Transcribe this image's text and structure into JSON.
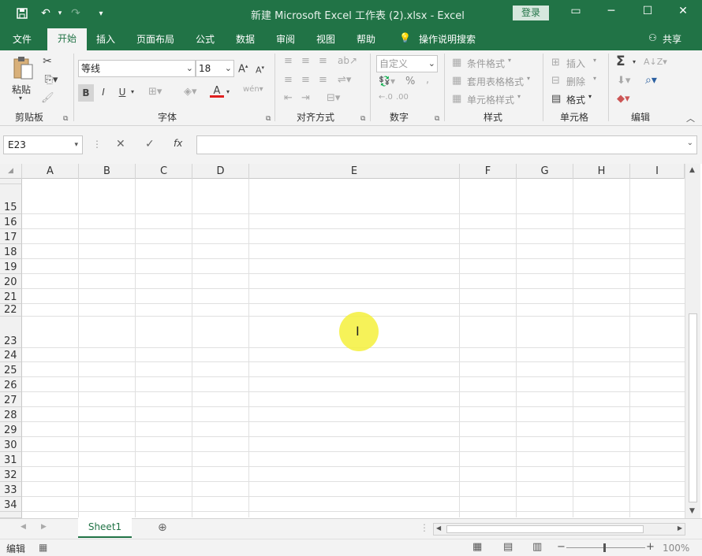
{
  "titlebar": {
    "title": "新建 Microsoft Excel 工作表 (2).xlsx  -  Excel",
    "login": "登录",
    "save_icon": "save-icon",
    "undo_icon": "undo-icon",
    "redo_icon": "redo-icon"
  },
  "tabs": [
    "文件",
    "开始",
    "插入",
    "页面布局",
    "公式",
    "数据",
    "审阅",
    "视图",
    "帮助"
  ],
  "tell_me": "操作说明搜索",
  "share": "共享",
  "ribbon": {
    "clipboard": {
      "paste": "粘贴",
      "label": "剪贴板"
    },
    "font": {
      "name": "等线",
      "size": "18",
      "bold": "B",
      "italic": "I",
      "underline": "U",
      "label": "字体"
    },
    "alignment": {
      "label": "对齐方式"
    },
    "number": {
      "format": "自定义",
      "label": "数字"
    },
    "styles": {
      "conditional": "条件格式",
      "table": "套用表格格式",
      "cell": "单元格样式",
      "label": "样式"
    },
    "cells": {
      "insert": "插入",
      "delete": "删除",
      "format": "格式",
      "label": "单元格"
    },
    "editing": {
      "label": "编辑"
    }
  },
  "formula_bar": {
    "name_box": "E23",
    "formula": "",
    "fx": "fx"
  },
  "columns": [
    "A",
    "B",
    "C",
    "D",
    "E",
    "F",
    "G",
    "H",
    "I"
  ],
  "rows": [
    "15",
    "16",
    "17",
    "18",
    "19",
    "20",
    "21",
    "22",
    "23",
    "24",
    "25",
    "26",
    "27",
    "28",
    "29",
    "30",
    "31",
    "32",
    "33",
    "34"
  ],
  "sheet_tab": "Sheet1",
  "status": {
    "mode": "编辑",
    "zoom": "100%"
  },
  "colors": {
    "accent": "#217346"
  }
}
